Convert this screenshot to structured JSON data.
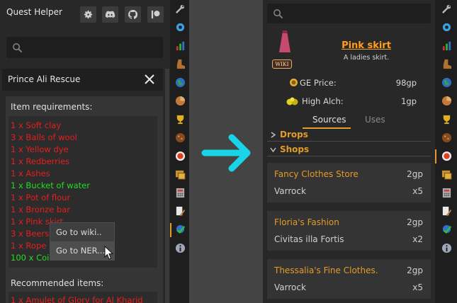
{
  "left": {
    "title": "Quest Helper",
    "search": {
      "value": "",
      "placeholder": ""
    },
    "quest_name": "Prince Ali Rescue",
    "item_requirements_title": "Item requirements:",
    "items": [
      {
        "text": "1 x Soft clay",
        "status": "red"
      },
      {
        "text": "3 x Balls of wool",
        "status": "red"
      },
      {
        "text": "1 x Yellow dye",
        "status": "red"
      },
      {
        "text": "1 x Redberries",
        "status": "red"
      },
      {
        "text": "1 x Ashes",
        "status": "red"
      },
      {
        "text": "1 x Bucket of water",
        "status": "green"
      },
      {
        "text": "1 x Pot of flour",
        "status": "red"
      },
      {
        "text": "1 x Bronze bar",
        "status": "red"
      },
      {
        "text": "1 x Pink skirt",
        "status": "red"
      },
      {
        "text": "3 x Beers",
        "status": "red"
      },
      {
        "text": "1 x Rope",
        "status": "red"
      },
      {
        "text": "100 x Coins",
        "status": "green"
      }
    ],
    "recommended_title": "Recommended items:",
    "recommended": [
      {
        "text": "1 x Amulet of Glory for Al Kharid",
        "status": "red"
      }
    ],
    "context_menu": {
      "items": [
        "Go to wiki..",
        "Go to NER..."
      ]
    }
  },
  "right": {
    "search": {
      "value": "",
      "placeholder": ""
    },
    "item_name": "Pink skirt",
    "item_desc": "A ladies skirt.",
    "wiki_badge": "WIKI",
    "ge_label": "GE Price:",
    "ge_value": "98gp",
    "alch_label": "High Alch:",
    "alch_value": "1gp",
    "tabs": [
      "Sources",
      "Uses"
    ],
    "sections": [
      "Drops",
      "Shops"
    ],
    "shops": [
      {
        "name": "Fancy Clothes Store",
        "location": "Varrock",
        "price": "2gp",
        "qty": "x5"
      },
      {
        "name": "Floria's Fashion",
        "location": "Civitas illa Fortis",
        "price": "2gp",
        "qty": "x2"
      },
      {
        "name": "Thessalia's Fine Clothes.",
        "location": "Varrock",
        "price": "2gp",
        "qty": "x5"
      }
    ]
  },
  "colors": {
    "accent": "#e39b29",
    "missing": "#e61e1e",
    "have": "#23dc23",
    "arrow": "#19d3e6"
  }
}
